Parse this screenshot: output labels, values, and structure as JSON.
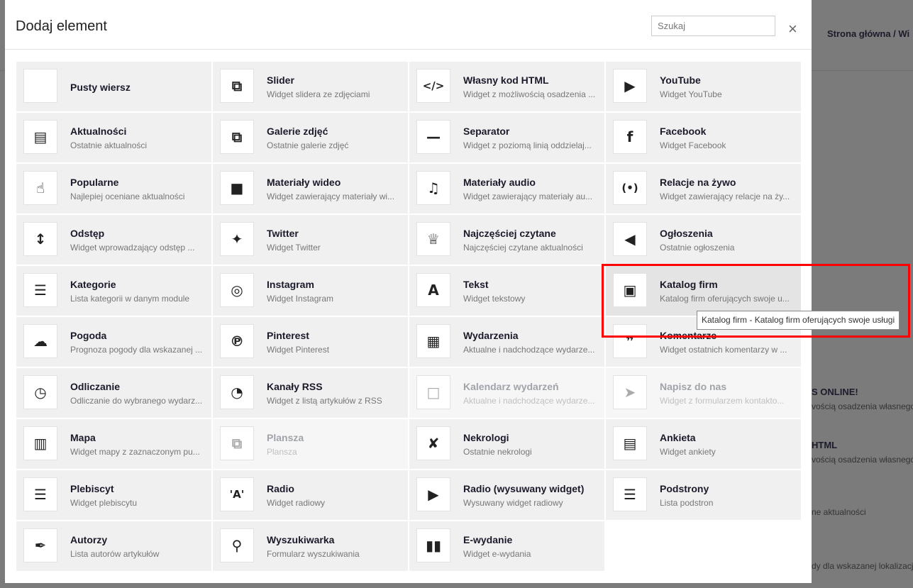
{
  "background": {
    "breadcrumb": "Strona główna  /  Wi",
    "fragments": [
      {
        "title": "S ONLINE!",
        "desc": "vością osadzenia własnego"
      },
      {
        "title": "HTML",
        "desc": "vością osadzenia własnego"
      },
      {
        "title": "",
        "desc": "ne aktualności"
      },
      {
        "title": "",
        "desc": "dy dla wskazanej lokalizacji"
      }
    ]
  },
  "modal": {
    "title": "Dodaj element",
    "search_placeholder": "Szukaj",
    "search_value": "",
    "close_label": "×"
  },
  "widgets": [
    {
      "title": "Pusty wiersz",
      "desc": "",
      "icon": "empty",
      "state": "empty"
    },
    {
      "title": "Slider",
      "desc": "Widget slidera ze zdjęciami",
      "icon": "images-icon"
    },
    {
      "title": "Własny kod HTML",
      "desc": "Widget z możliwością osadzenia ...",
      "icon": "code-icon"
    },
    {
      "title": "YouTube",
      "desc": "Widget YouTube",
      "icon": "youtube-icon"
    },
    {
      "title": "Aktualności",
      "desc": "Ostatnie aktualności",
      "icon": "newspaper-icon"
    },
    {
      "title": "Galerie zdjęć",
      "desc": "Ostatnie galerie zdjęć",
      "icon": "gallery-icon"
    },
    {
      "title": "Separator",
      "desc": "Widget z poziomą linią oddzielaj...",
      "icon": "minus-icon"
    },
    {
      "title": "Facebook",
      "desc": "Widget Facebook",
      "icon": "facebook-icon"
    },
    {
      "title": "Popularne",
      "desc": "Najlepiej oceniane aktualności",
      "icon": "thumbs-up-icon"
    },
    {
      "title": "Materiały wideo",
      "desc": "Widget zawierający materiały wi...",
      "icon": "video-icon"
    },
    {
      "title": "Materiały audio",
      "desc": "Widget zawierający materiały au...",
      "icon": "volume-icon"
    },
    {
      "title": "Relacje na żywo",
      "desc": "Widget zawierający relacje na ży...",
      "icon": "broadcast-icon"
    },
    {
      "title": "Odstęp",
      "desc": "Widget wprowadzający odstęp ...",
      "icon": "arrows-vertical-icon"
    },
    {
      "title": "Twitter",
      "desc": "Widget Twitter",
      "icon": "twitter-icon"
    },
    {
      "title": "Najczęściej czytane",
      "desc": "Najczęściej czytane aktualności",
      "icon": "trophy-icon"
    },
    {
      "title": "Ogłoszenia",
      "desc": "Ostatnie ogłoszenia",
      "icon": "megaphone-icon"
    },
    {
      "title": "Kategorie",
      "desc": "Lista kategorii w danym module",
      "icon": "list-icon"
    },
    {
      "title": "Instagram",
      "desc": "Widget Instagram",
      "icon": "instagram-icon"
    },
    {
      "title": "Tekst",
      "desc": "Widget tekstowy",
      "icon": "font-icon"
    },
    {
      "title": "Katalog firm",
      "desc": "Katalog firm oferujących swoje u...",
      "icon": "briefcase-icon",
      "state": "hover"
    },
    {
      "title": "Pogoda",
      "desc": "Prognoza pogody dla wskazanej ...",
      "icon": "cloud-icon"
    },
    {
      "title": "Pinterest",
      "desc": "Widget Pinterest",
      "icon": "pinterest-icon"
    },
    {
      "title": "Wydarzenia",
      "desc": "Aktualne i nadchodzące wydarze...",
      "icon": "calendar-icon"
    },
    {
      "title": "Komentarze",
      "desc": "Widget ostatnich komentarzy w ...",
      "icon": "comments-icon"
    },
    {
      "title": "Odliczanie",
      "desc": "Odliczanie do wybranego wydarz...",
      "icon": "clock-icon"
    },
    {
      "title": "Kanały RSS",
      "desc": "Widget z listą artykułów z RSS",
      "icon": "rss-icon"
    },
    {
      "title": "Kalendarz wydarzeń",
      "desc": "Aktualne i nadchodzące wydarze...",
      "icon": "calendar-empty-icon",
      "state": "disabled"
    },
    {
      "title": "Napisz do nas",
      "desc": "Widget z formularzem kontakto...",
      "icon": "paper-plane-icon",
      "state": "disabled"
    },
    {
      "title": "Mapa",
      "desc": "Widget mapy z zaznaczonym pu...",
      "icon": "map-icon"
    },
    {
      "title": "Plansza",
      "desc": "Plansza",
      "icon": "images-icon",
      "state": "disabled"
    },
    {
      "title": "Nekrologi",
      "desc": "Ostatnie nekrologi",
      "icon": "ribbon-icon"
    },
    {
      "title": "Ankieta",
      "desc": "Widget ankiety",
      "icon": "poll-icon"
    },
    {
      "title": "Plebiscyt",
      "desc": "Widget plebiscytu",
      "icon": "server-icon"
    },
    {
      "title": "Radio",
      "desc": "Widget radiowy",
      "icon": "radio-tower-icon"
    },
    {
      "title": "Radio (wysuwany widget)",
      "desc": "Wysuwany widget radiowy",
      "icon": "play-icon"
    },
    {
      "title": "Podstrony",
      "desc": "Lista podstron",
      "icon": "list-icon"
    },
    {
      "title": "Autorzy",
      "desc": "Lista autorów artykułów",
      "icon": "feather-icon"
    },
    {
      "title": "Wyszukiwarka",
      "desc": "Formularz wyszukiwania",
      "icon": "search-icon"
    },
    {
      "title": "E-wydanie",
      "desc": "Widget e-wydania",
      "icon": "book-icon"
    }
  ],
  "tooltip": "Katalog firm - Katalog firm oferujących swoje usługi",
  "colors": {
    "highlight": "#ff0000",
    "cell_bg": "#f0f0f0",
    "overlay": "#7b7b7b"
  }
}
